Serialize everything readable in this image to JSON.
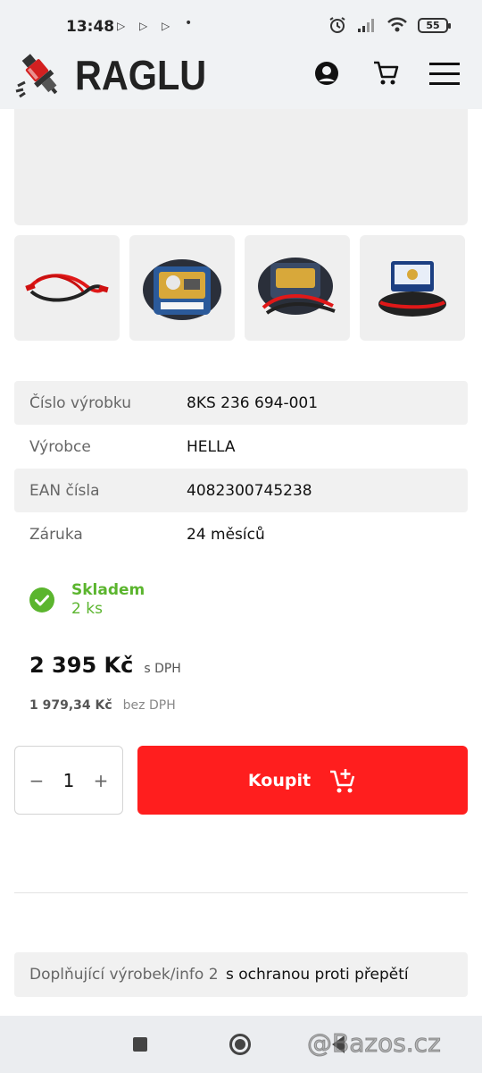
{
  "status_bar": {
    "time": "13:48",
    "battery": "55"
  },
  "header": {
    "logo_text": "RAGLU",
    "icons": [
      "account-icon",
      "cart-icon",
      "menu-icon"
    ]
  },
  "gallery": {
    "thumbnails": [
      "jumper-cables-red",
      "jumper-cables-bag",
      "jumper-cables-bag-open",
      "jumper-cables-case"
    ]
  },
  "specs": [
    {
      "label": "Číslo výrobku",
      "value": "8KS 236 694-001"
    },
    {
      "label": "Výrobce",
      "value": "HELLA"
    },
    {
      "label": "EAN čísla",
      "value": "4082300745238"
    },
    {
      "label": "Záruka",
      "value": "24 měsíců"
    }
  ],
  "stock": {
    "title": "Skladem",
    "quantity": "2 ks",
    "color": "#5bb52e"
  },
  "price": {
    "with_vat": "2 395 Kč",
    "with_vat_label": "s DPH",
    "without_vat": "1 979,34 Kč",
    "without_vat_label": "bez DPH"
  },
  "purchase": {
    "minus": "−",
    "quantity": "1",
    "plus": "+",
    "buy_label": "Koupit",
    "buy_color": "#ff1e1e"
  },
  "extra_info": {
    "label": "Doplňující výrobek/info 2",
    "value": "s ochranou proti přepětí"
  },
  "watermark": "@Bazos.cz"
}
